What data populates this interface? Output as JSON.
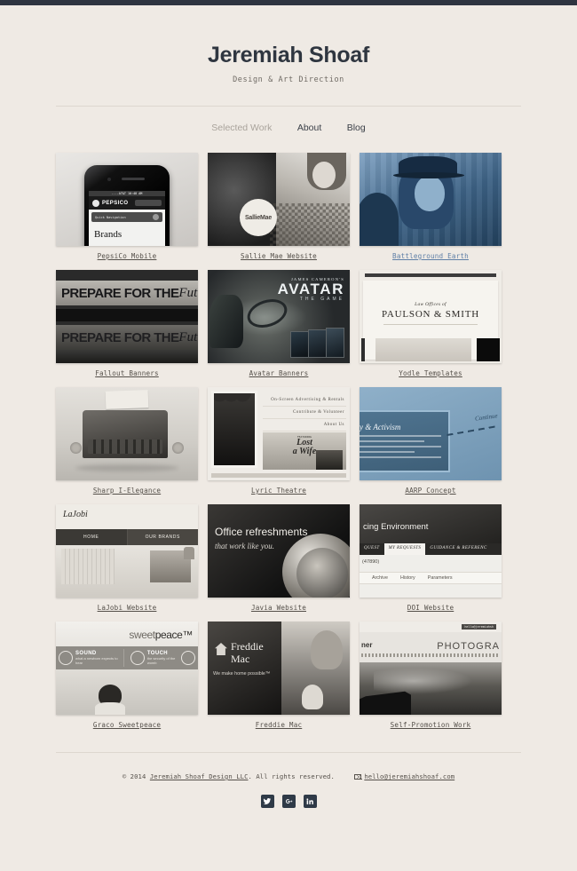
{
  "site": {
    "title": "Jeremiah Shoaf",
    "tagline": "Design & Art Direction"
  },
  "nav": {
    "items": [
      {
        "label": "Selected Work",
        "state": "current"
      },
      {
        "label": "About",
        "state": "default"
      },
      {
        "label": "Blog",
        "state": "default"
      }
    ]
  },
  "work": {
    "items": [
      {
        "caption": "PepsiCo Mobile",
        "style": "dark",
        "art": {
          "brand": "PEPSICO",
          "status": "....AT&T   10:48 AM",
          "nav": "Quick Navigation",
          "heading": "Brands"
        }
      },
      {
        "caption": "Sallie Mae Website",
        "style": "dark",
        "art": {
          "badge": "SallieMae"
        }
      },
      {
        "caption": "Battleground Earth",
        "style": "link"
      },
      {
        "caption": "Fallout Banners",
        "style": "dark",
        "art": {
          "line": "PREPARE FOR THE",
          "script": "Future"
        }
      },
      {
        "caption": "Avatar Banners",
        "style": "dark",
        "art": {
          "pre": "JAMES CAMERON'S",
          "title": "AVATAR",
          "sub": "THE GAME"
        }
      },
      {
        "caption": "Yodle Templates",
        "style": "dark",
        "art": {
          "eyebrow": "Law Offices of",
          "firm": "PAULSON & SMITH"
        }
      },
      {
        "caption": "Sharp I-Elegance",
        "style": "dark"
      },
      {
        "caption": "Lyric Theatre",
        "style": "dark",
        "art": {
          "menu": [
            "On-Screen Advertising & Rentals",
            "Contribute & Volunteer",
            "About Us"
          ],
          "poster_pre": "FEATURING",
          "poster_title_1": "Lost",
          "poster_title_2": "a Wife"
        }
      },
      {
        "caption": "AARP Concept",
        "style": "dark",
        "art": {
          "heading": "y & Activism",
          "body": "elite, one in four voters is an AARP member.",
          "cta": "Continue"
        }
      },
      {
        "caption": "LaJobi Website",
        "style": "dark",
        "art": {
          "logo": "LaJobi",
          "nav": [
            "HOME",
            "OUR BRANDS"
          ]
        }
      },
      {
        "caption": "Javia Website",
        "style": "dark",
        "art": {
          "heading": "Office refreshments",
          "sub": "that work like you."
        }
      },
      {
        "caption": "DOI Website",
        "style": "dark",
        "art": {
          "heading": "cing Environment",
          "tabs": [
            "QUEST",
            "MY REQUESTS",
            "GUIDANCE & REFERENC"
          ],
          "record": "(47890)",
          "subtabs": [
            "Archive",
            "History",
            "Parameters"
          ]
        }
      },
      {
        "caption": "Graco Sweetpeace",
        "style": "dark",
        "art": {
          "logo_light": "sweet",
          "logo_dark": "peace™",
          "f1_title": "SOUND",
          "f1_desc": "what a newborn expects to hear",
          "f2_title": "TOUCH",
          "f2_desc": "the security of the womb"
        }
      },
      {
        "caption": "Freddie Mac",
        "style": "dark",
        "art": {
          "name_1": "Freddie",
          "name_2": "Mac",
          "tagline": "We make home possible™"
        }
      },
      {
        "caption": "Self-Promotion Work",
        "style": "dark",
        "art": {
          "mail": "hello@jeremiahsh",
          "left": "ner",
          "word": "PHOTOGRA"
        }
      }
    ]
  },
  "footer": {
    "copyright_pre": "© 2014 ",
    "copyright_link": "Jeremiah Shoaf Design LLC",
    "copyright_post": ". All rights reserved.",
    "email": "hello@jeremiahshoaf.com",
    "social": [
      {
        "name": "twitter",
        "glyph": "t"
      },
      {
        "name": "google-plus",
        "glyph": "g"
      },
      {
        "name": "linkedin",
        "glyph": "in"
      }
    ]
  }
}
